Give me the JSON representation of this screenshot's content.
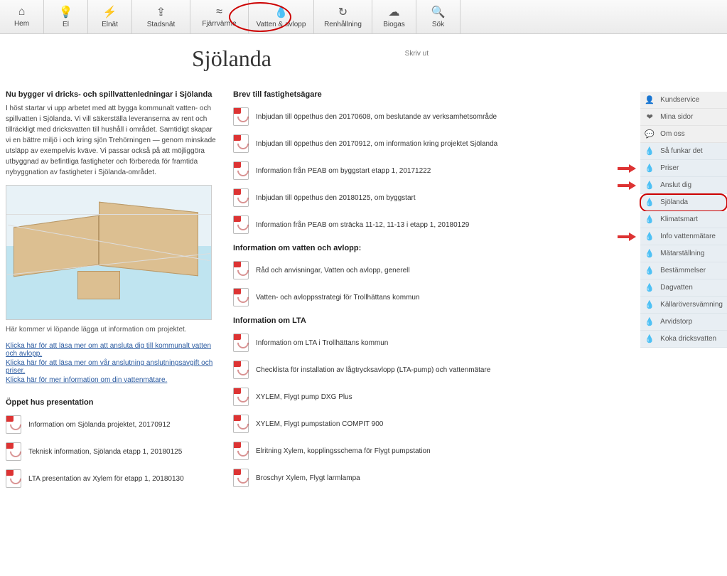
{
  "topnav": [
    {
      "icon": "⌂",
      "label": "Hem"
    },
    {
      "icon": "💡",
      "label": "El"
    },
    {
      "icon": "⚡",
      "label": "Elnät"
    },
    {
      "icon": "⇪",
      "label": "Stadsnät"
    },
    {
      "icon": "≈",
      "label": "Fjärrvärme"
    },
    {
      "icon": "💧",
      "label": "Vatten & avlopp"
    },
    {
      "icon": "↻",
      "label": "Renhållning"
    },
    {
      "icon": "☁",
      "label": "Biogas"
    },
    {
      "icon": "🔍",
      "label": "Sök"
    }
  ],
  "page": {
    "title": "Sjölanda",
    "print": "Skriv ut"
  },
  "left": {
    "heading": "Nu bygger vi dricks- och spillvattenledningar i Sjölanda",
    "intro": "I höst startar vi upp arbetet med att bygga kommunalt vatten- och spillvatten i Sjölanda. Vi vill säkerställa leveranserna av rent och tillräckligt med dricksvatten till hushåll i området. Samtidigt skapar vi en bättre miljö i och kring sjön Trehörningen — genom minskade utsläpp av exempelvis kväve. Vi passar också på att möjliggöra utbyggnad av befintliga fastigheter och förbereda för framtida nybyggnation av fastigheter i Sjölanda-området.",
    "caption": "Här kommer vi löpande lägga ut information om projektet.",
    "links": [
      "Klicka här för att läsa mer om att ansluta dig till kommunalt vatten och avlopp.",
      "Klicka här för att läsa mer om vår anslutning anslutningsavgift och priser.",
      "Klicka här för mer information om din vattenmätare."
    ],
    "pres_heading": "Öppet hus presentation",
    "pres_docs": [
      "Information om Sjölanda projektet, 20170912",
      "Teknisk information, Sjölanda etapp 1, 20180125",
      "LTA presentation av Xylem för etapp 1, 20180130"
    ]
  },
  "mid": {
    "brev_heading": "Brev till fastighetsägare",
    "brev_docs": [
      "Inbjudan till öppethus den 20170608, om beslutande av verksamhetsområde",
      "Inbjudan till öppethus den 20170912, om information kring projektet Sjölanda",
      "Information från PEAB om byggstart etapp 1, 20171222",
      "Inbjudan till öppethus den 20180125, om byggstart",
      "Information från PEAB om sträcka 11-12, 11-13 i etapp 1, 20180129"
    ],
    "va_heading": "Information om vatten och avlopp:",
    "va_docs": [
      "Råd och anvisningar, Vatten och avlopp, generell",
      "Vatten- och avloppsstrategi för Trollhättans kommun"
    ],
    "lta_heading": "Information om LTA",
    "lta_docs": [
      "Information om LTA i Trollhättans kommun",
      "Checklista för installation av lågtrycksavlopp (LTA-pump) och vattenmätare",
      "XYLEM, Flygt pump DXG Plus",
      "XYLEM, Flygt pumpstation COMPIT 900",
      "Elritning Xylem, kopplingsschema för Flygt pumpstation",
      "Broschyr Xylem, Flygt larmlampa"
    ]
  },
  "sidebar": {
    "top": [
      {
        "icon": "👤",
        "label": "Kundservice"
      },
      {
        "icon": "❤",
        "label": "Mina sidor"
      },
      {
        "icon": "💬",
        "label": "Om oss"
      }
    ],
    "blue": [
      {
        "icon": "💧",
        "label": "Så funkar det"
      },
      {
        "icon": "💧",
        "label": "Priser",
        "arrow": true
      },
      {
        "icon": "💧",
        "label": "Anslut dig",
        "arrow": true
      },
      {
        "icon": "💧",
        "label": "Sjölanda",
        "active": true
      },
      {
        "icon": "💧",
        "label": "Klimatsmart"
      },
      {
        "icon": "💧",
        "label": "Info vattenmätare",
        "arrow": true
      },
      {
        "icon": "💧",
        "label": "Mätarställning"
      },
      {
        "icon": "💧",
        "label": "Bestämmelser"
      },
      {
        "icon": "💧",
        "label": "Dagvatten"
      },
      {
        "icon": "💧",
        "label": "Källaröversvämning"
      },
      {
        "icon": "💧",
        "label": "Arvidstorp"
      },
      {
        "icon": "💧",
        "label": "Koka dricksvatten"
      }
    ]
  }
}
